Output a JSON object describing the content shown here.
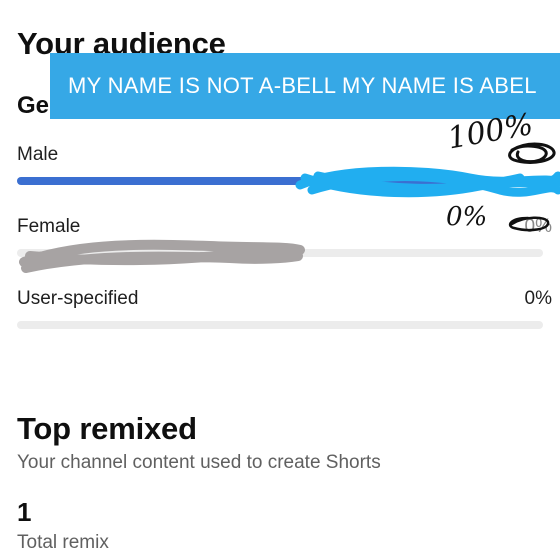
{
  "audience": {
    "title": "Your audience",
    "gender_heading": "Gender",
    "rows": [
      {
        "label": "Male",
        "value_text": "100%",
        "fraction": 1.0
      },
      {
        "label": "Female",
        "value_text": "0%",
        "fraction": 0.0
      },
      {
        "label": "User-specified",
        "value_text": "0%",
        "fraction": 0.0
      }
    ]
  },
  "annotation": {
    "banner_text": "MY NAME IS NOT  A-BELL MY NAME IS ABEL",
    "handwritten_male": "100%",
    "handwritten_female": "0%",
    "colors": {
      "banner": "#36a8e6",
      "scribble_blue": "#21aef0",
      "scribble_gray": "#a7a3a3",
      "bar_fill": "#3b6fd1"
    }
  },
  "remixed": {
    "title": "Top remixed",
    "subtitle": "Your channel content used to create Shorts",
    "total_value": "1",
    "total_label": "Total remix"
  }
}
